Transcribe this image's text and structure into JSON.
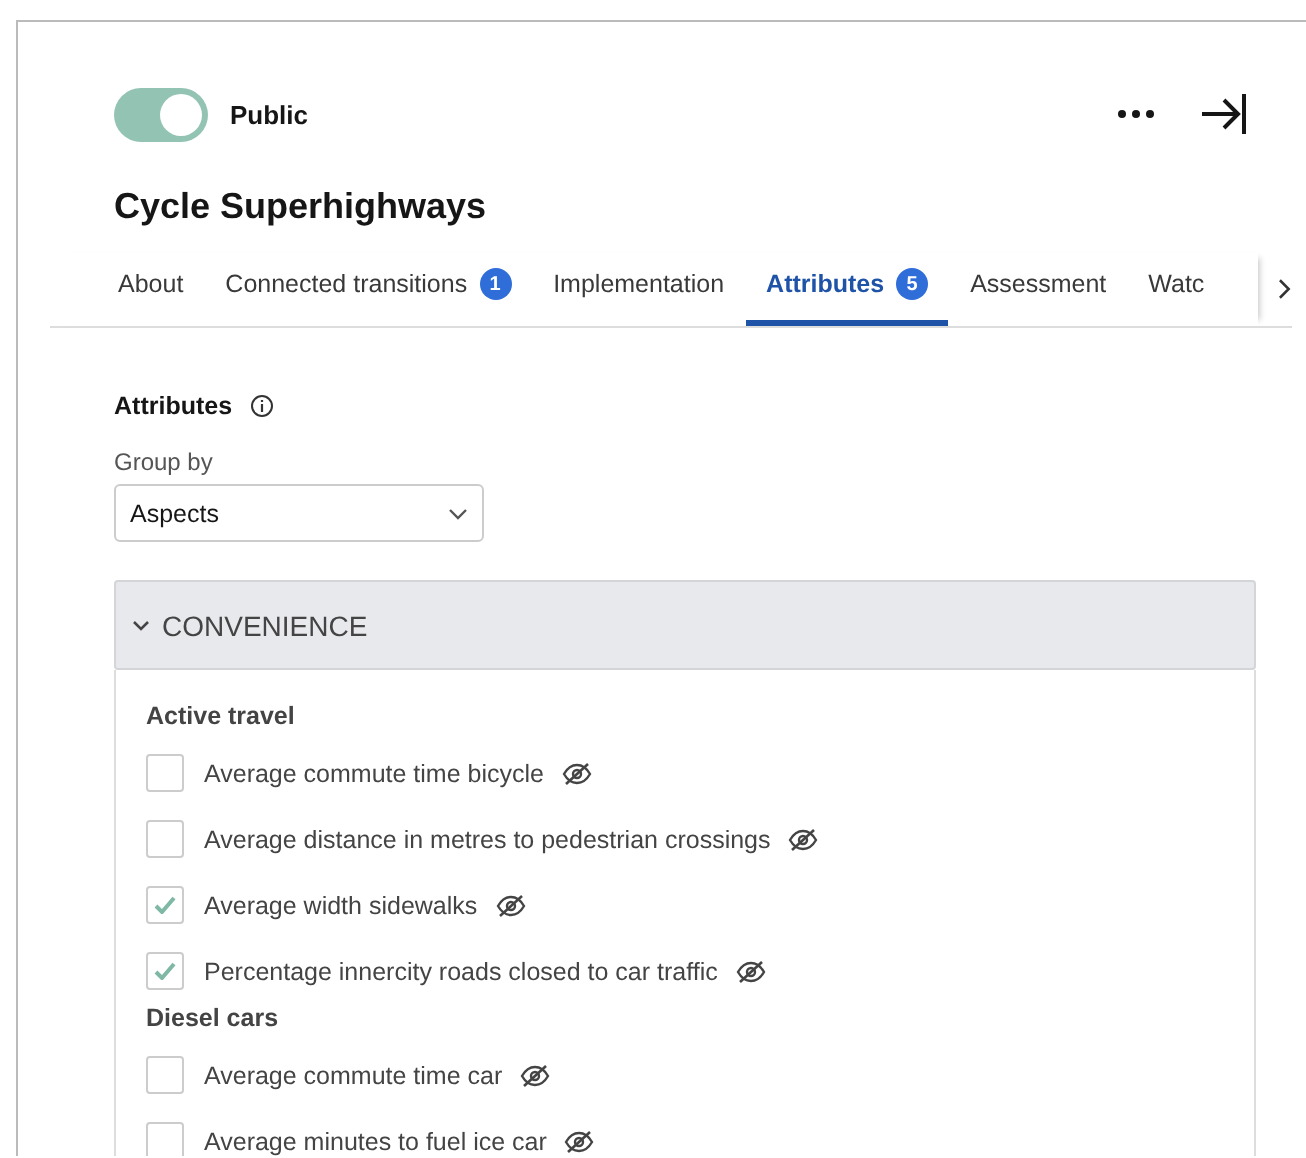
{
  "visibility_toggle": {
    "label": "Public",
    "on": true
  },
  "title": "Cycle Superhighways",
  "tabs": [
    {
      "label": "About",
      "selected": false
    },
    {
      "label": "Connected transitions",
      "badge": "1",
      "selected": false
    },
    {
      "label": "Implementation",
      "selected": false
    },
    {
      "label": "Attributes",
      "badge": "5",
      "selected": true
    },
    {
      "label": "Assessment",
      "selected": false
    },
    {
      "label": "Watc",
      "selected": false
    }
  ],
  "section_title": "Attributes",
  "group_by": {
    "label": "Group by",
    "value": "Aspects"
  },
  "groups": [
    {
      "title": "CONVENIENCE",
      "expanded": true,
      "subgroups": [
        {
          "title": "Active travel",
          "items": [
            {
              "label": "Average commute time bicycle",
              "checked": false,
              "hidden": true
            },
            {
              "label": "Average distance in metres to pedestrian crossings",
              "checked": false,
              "hidden": true
            },
            {
              "label": "Average width sidewalks",
              "checked": true,
              "hidden": true
            },
            {
              "label": "Percentage innercity roads closed to car traffic",
              "checked": true,
              "hidden": true
            }
          ]
        },
        {
          "title": "Diesel cars",
          "items": [
            {
              "label": "Average commute time car",
              "checked": false,
              "hidden": true
            },
            {
              "label": "Average minutes to fuel ice car",
              "checked": false,
              "hidden": true
            }
          ]
        }
      ]
    }
  ]
}
